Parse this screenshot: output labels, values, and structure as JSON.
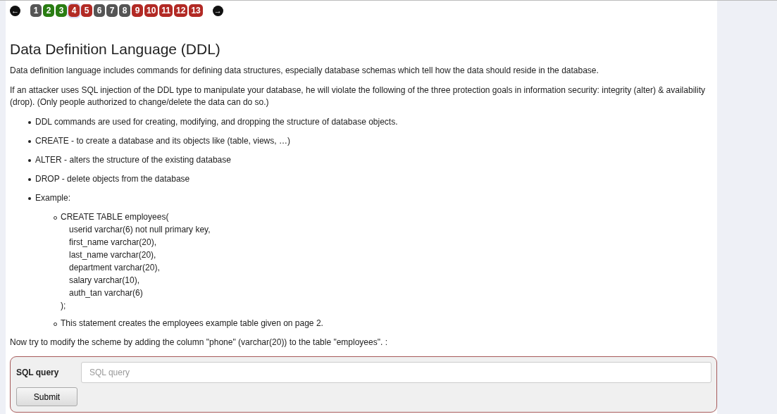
{
  "pager": {
    "prev": "←",
    "next": "→",
    "pages": [
      {
        "label": "1",
        "color": "#555555",
        "selected": false
      },
      {
        "label": "2",
        "color": "#2a7d13",
        "selected": false
      },
      {
        "label": "3",
        "color": "#2a7d13",
        "selected": false
      },
      {
        "label": "4",
        "color": "#b22a25",
        "selected": true
      },
      {
        "label": "5",
        "color": "#b22a25",
        "selected": false
      },
      {
        "label": "6",
        "color": "#555555",
        "selected": false
      },
      {
        "label": "7",
        "color": "#555555",
        "selected": false
      },
      {
        "label": "8",
        "color": "#555555",
        "selected": false
      },
      {
        "label": "9",
        "color": "#b22a25",
        "selected": false
      },
      {
        "label": "10",
        "color": "#b22a25",
        "selected": false
      },
      {
        "label": "11",
        "color": "#b22a25",
        "selected": false
      },
      {
        "label": "12",
        "color": "#b22a25",
        "selected": false
      },
      {
        "label": "13",
        "color": "#b22a25",
        "selected": false
      }
    ]
  },
  "title": "Data Definition Language (DDL)",
  "paragraphs": [
    "Data definition language includes commands for defining data structures, especially database schemas which tell how the data should reside in the database.",
    "If an attacker uses SQL injection of the DDL type to manipulate your database, he will violate the following of the three protection goals in information security: integrity (alter) & availability (drop). (Only people authorized to change/delete the data can do so.)"
  ],
  "bullets": [
    {
      "text": "DDL commands are used for creating, modifying, and dropping the structure of database objects."
    },
    {
      "text": "CREATE - to create a database and its objects like (table, views, …)"
    },
    {
      "text": "ALTER - alters the structure of the existing database"
    },
    {
      "text": "DROP - delete objects from the database"
    },
    {
      "text": "Example:",
      "children": [
        {
          "text": "CREATE TABLE employees(",
          "code": [
            "userid varchar(6) not null primary key,",
            "first_name varchar(20),",
            "last_name varchar(20),",
            "department varchar(20),",
            "salary varchar(10),",
            "auth_tan varchar(6)"
          ],
          "closing": ");"
        },
        {
          "text": "This statement creates the employees example table given on page 2."
        }
      ]
    }
  ],
  "instruction": "Now try to modify the scheme by adding the column \"phone\" (varchar(20)) to the table \"employees\". :",
  "form": {
    "label": "SQL query",
    "placeholder": "SQL query",
    "button": "Submit"
  }
}
